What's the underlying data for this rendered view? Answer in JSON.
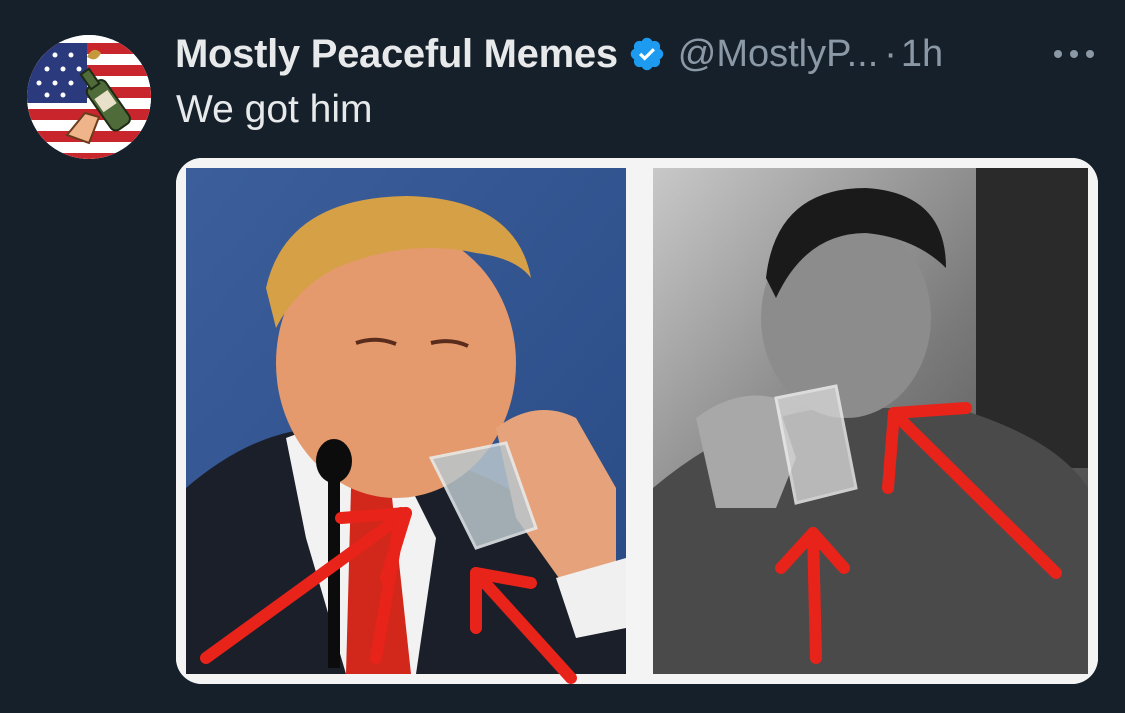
{
  "author": {
    "display_name": "Mostly Peaceful Memes",
    "handle": "@MostlyP...",
    "separator": "·",
    "time": "1h",
    "verified_icon": "verified-badge-icon",
    "avatar_icon": "american-flag-bottle-avatar"
  },
  "tweet": {
    "text": "We got him"
  },
  "media": {
    "layout": "two-panel-image",
    "left_panel": "man-in-suit-drinking-water-with-red-arrows",
    "right_panel": "black-and-white-man-drinking-with-red-arrows",
    "arrow_color": "#e8231a"
  },
  "actions": {
    "more_icon": "more-options-icon"
  },
  "colors": {
    "background": "#15202b",
    "text_primary": "#e7e9ea",
    "text_secondary": "#8b98a5",
    "verified_blue": "#1d9bf0"
  }
}
